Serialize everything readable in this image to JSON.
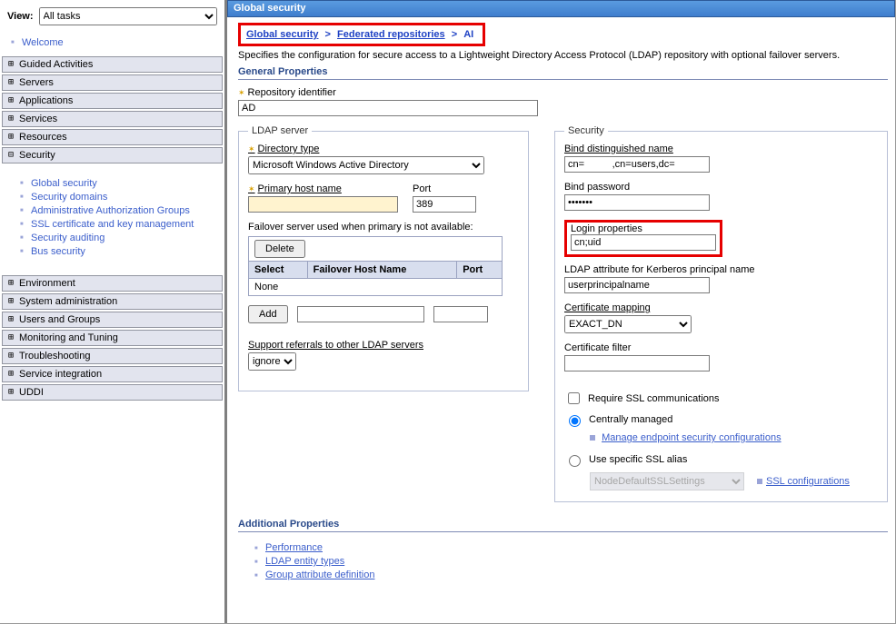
{
  "nav": {
    "view_label": "View:",
    "view_value": "All tasks",
    "welcome": "Welcome",
    "items": {
      "guided": "Guided Activities",
      "servers": "Servers",
      "applications": "Applications",
      "services": "Services",
      "resources": "Resources",
      "security": "Security",
      "environment": "Environment",
      "sysadmin": "System administration",
      "users_groups": "Users and Groups",
      "monitoring": "Monitoring and Tuning",
      "troubleshooting": "Troubleshooting",
      "service_integration": "Service integration",
      "uddi": "UDDI"
    },
    "security_children": [
      "Global security",
      "Security domains",
      "Administrative Authorization Groups",
      "SSL certificate and key management",
      "Security auditing",
      "Bus security"
    ]
  },
  "title": "Global security",
  "crumb": {
    "a": "Global security",
    "b": "Federated repositories",
    "c": "AI"
  },
  "description": "Specifies the configuration for secure access to a Lightweight Directory Access Protocol (LDAP) repository with optional failover servers.",
  "section_general": "General Properties",
  "repo_id_label": "Repository identifier",
  "repo_id_value": "AD",
  "ldap": {
    "legend": "LDAP server",
    "dir_type_label": "Directory type",
    "dir_type_value": "Microsoft Windows Active Directory",
    "host_label": "Primary host name",
    "host_value": "",
    "port_label": "Port",
    "port_value": "389",
    "failover_label": "Failover server used when primary is not available:",
    "delete": "Delete",
    "th_select": "Select",
    "th_host": "Failover Host Name",
    "th_port": "Port",
    "none": "None",
    "add": "Add",
    "referrals_label": "Support referrals to other LDAP servers",
    "referrals_value": "ignore"
  },
  "sec": {
    "legend": "Security",
    "bind_dn_label": "Bind distinguished name",
    "bind_dn_value": "cn=          ,cn=users,dc=",
    "bind_pw_label": "Bind password",
    "bind_pw_value": "•••••••",
    "login_props_label": "Login properties",
    "login_props_value": "cn;uid",
    "kerb_label": "LDAP attribute for Kerberos principal name",
    "kerb_value": "userprincipalname",
    "cert_map_label": "Certificate mapping",
    "cert_map_value": "EXACT_DN",
    "cert_filter_label": "Certificate filter",
    "cert_filter_value": "",
    "require_ssl": "Require SSL communications",
    "centrally": "Centrally managed",
    "manage_endpoint": "Manage endpoint security configurations",
    "use_alias": "Use specific SSL alias",
    "alias_value": "NodeDefaultSSLSettings",
    "ssl_configs": "SSL configurations"
  },
  "addl": {
    "heading": "Additional Properties",
    "items": [
      "Performance",
      "LDAP entity types",
      "Group attribute definition"
    ]
  }
}
